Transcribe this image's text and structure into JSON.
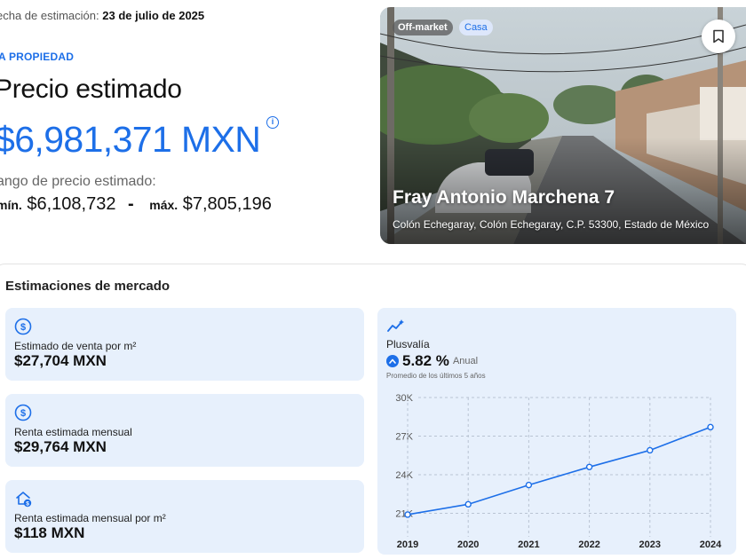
{
  "summary": {
    "date_label": "echa de estimación:",
    "date_value": "23 de julio de 2025",
    "eyebrow": "A PROPIEDAD",
    "title": "Precio estimado",
    "price": "$6,981,371 MXN",
    "range_label": "ango de precio estimado:",
    "min_label": "mín.",
    "min_value": "$6,108,732",
    "separator": "-",
    "max_label": "máx.",
    "max_value": "$7,805,196"
  },
  "property": {
    "badges": [
      "Off-market",
      "Casa"
    ],
    "title": "Fray Antonio Marchena 7",
    "address": "Colón Echegaray, Colón Echegaray, C.P. 53300, Estado de México"
  },
  "market": {
    "title": "Estimaciones de mercado",
    "cards": [
      {
        "icon": "dollar-circle-icon",
        "label": "Estimado de venta por m²",
        "value": "$27,704 MXN"
      },
      {
        "icon": "dollar-circle-icon",
        "label": "Renta estimada mensual",
        "value": "$29,764 MXN"
      },
      {
        "icon": "house-dollar-icon",
        "label": "Renta estimada mensual por m²",
        "value": "$118 MXN"
      }
    ],
    "plusvalia": {
      "icon": "trend-sparkle-icon",
      "label": "Plusvalía",
      "rate": "5.82 %",
      "rate_unit": "Anual",
      "note": "Promedio de los últimos 5 años"
    }
  },
  "colors": {
    "accent": "#1d6fe8",
    "card_bg": "#e7f0fc"
  },
  "chart_data": {
    "type": "line",
    "x": [
      "2019",
      "2020",
      "2021",
      "2022",
      "2023",
      "2024"
    ],
    "series": [
      {
        "values": [
          20900,
          21700,
          23200,
          24600,
          25900,
          27700
        ]
      }
    ],
    "y_ticks": [
      "30K",
      "27K",
      "24K",
      "21K"
    ],
    "y_tick_values": [
      30000,
      27000,
      24000,
      21000
    ],
    "ylim": [
      20000,
      30000
    ],
    "grid": true
  }
}
